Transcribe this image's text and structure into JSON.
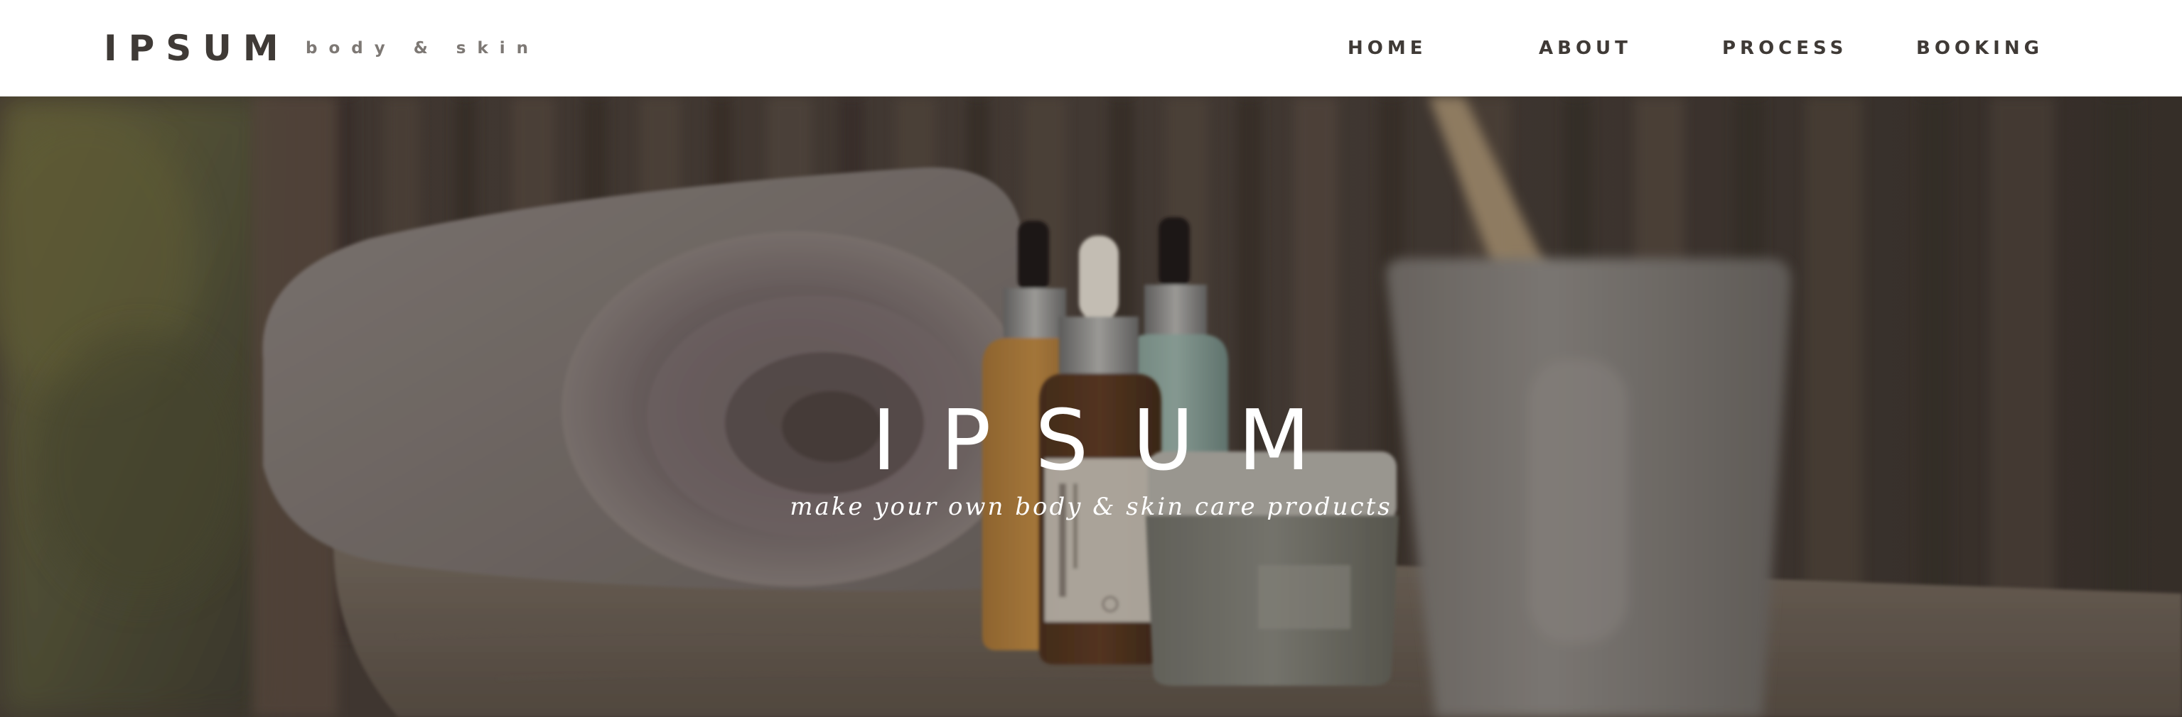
{
  "brand": {
    "logo": "IPSUM",
    "tagline": "body & skin"
  },
  "nav": {
    "items": [
      {
        "label": "HOME"
      },
      {
        "label": "ABOUT"
      },
      {
        "label": "PROCESS"
      },
      {
        "label": "BOOKING"
      }
    ]
  },
  "hero": {
    "title": "IPSUM",
    "subtitle": "make your own body & skin care products"
  },
  "colors": {
    "header_bg": "#ffffff",
    "brand_text": "#3f3a36",
    "tagline_text": "#7d7874",
    "hero_text": "#ffffff",
    "hero_overlay": "#221c18"
  }
}
